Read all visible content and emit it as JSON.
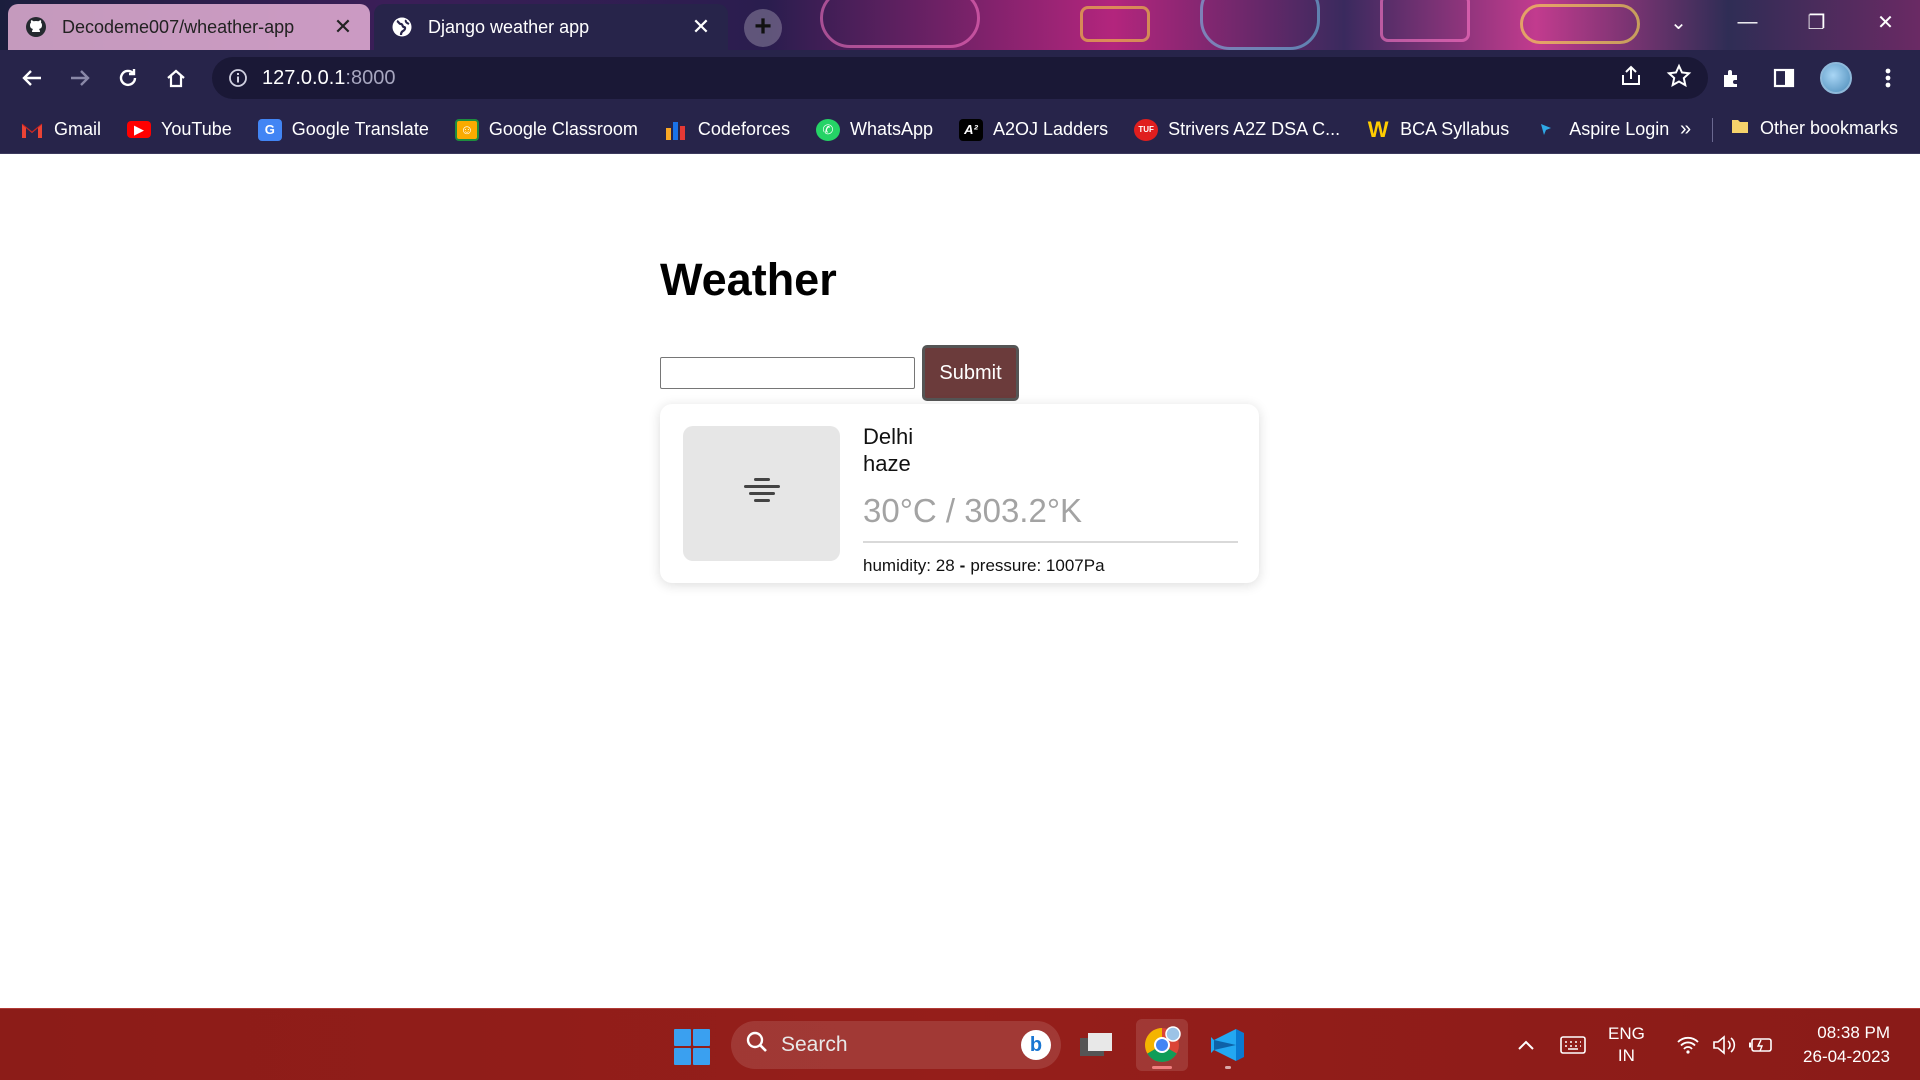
{
  "browser": {
    "tabs": [
      {
        "title": "Decodeme007/wheather-app",
        "icon": "github-icon",
        "active": false
      },
      {
        "title": "Django weather app",
        "icon": "globe-icon",
        "active": true
      }
    ],
    "new_tab_label": "+",
    "address": {
      "host": "127.0.0.1",
      "port": ":8000"
    },
    "bookmarks": [
      {
        "label": "Gmail",
        "icon": "gmail-icon",
        "color": "#ea4335"
      },
      {
        "label": "YouTube",
        "icon": "youtube-icon",
        "color": "#ff0000"
      },
      {
        "label": "Google Translate",
        "icon": "google-translate-icon",
        "color": "#4285f4"
      },
      {
        "label": "Google Classroom",
        "icon": "google-classroom-icon",
        "color": "#f9ab00"
      },
      {
        "label": "Codeforces",
        "icon": "codeforces-icon",
        "color": "#1a73e8"
      },
      {
        "label": "WhatsApp",
        "icon": "whatsapp-icon",
        "color": "#25d366"
      },
      {
        "label": "A2OJ Ladders",
        "icon": "a2oj-icon",
        "color": "#000000"
      },
      {
        "label": "Strivers A2Z DSA C...",
        "icon": "tuf-icon",
        "color": "#e01e1e"
      },
      {
        "label": "BCA Syllabus",
        "icon": "w-icon",
        "color": "#ffcc00"
      },
      {
        "label": "Aspire Login",
        "icon": "aspire-icon",
        "color": "#2ea8e6"
      }
    ],
    "more_bookmarks": "»",
    "other_bookmarks": "Other bookmarks"
  },
  "page": {
    "title": "Weather",
    "form": {
      "input_value": "",
      "submit_label": "Submit"
    },
    "card": {
      "city": "Delhi",
      "description": "haze",
      "temperature": "30°C / 303.2°K",
      "humidity": "humidity: 28",
      "separator": "-",
      "pressure": "pressure: 1007Pa",
      "icon": "haze-icon"
    }
  },
  "taskbar": {
    "search_label": "Search",
    "language": {
      "line1": "ENG",
      "line2": "IN"
    },
    "time": "08:38 PM",
    "date": "26-04-2023"
  }
}
